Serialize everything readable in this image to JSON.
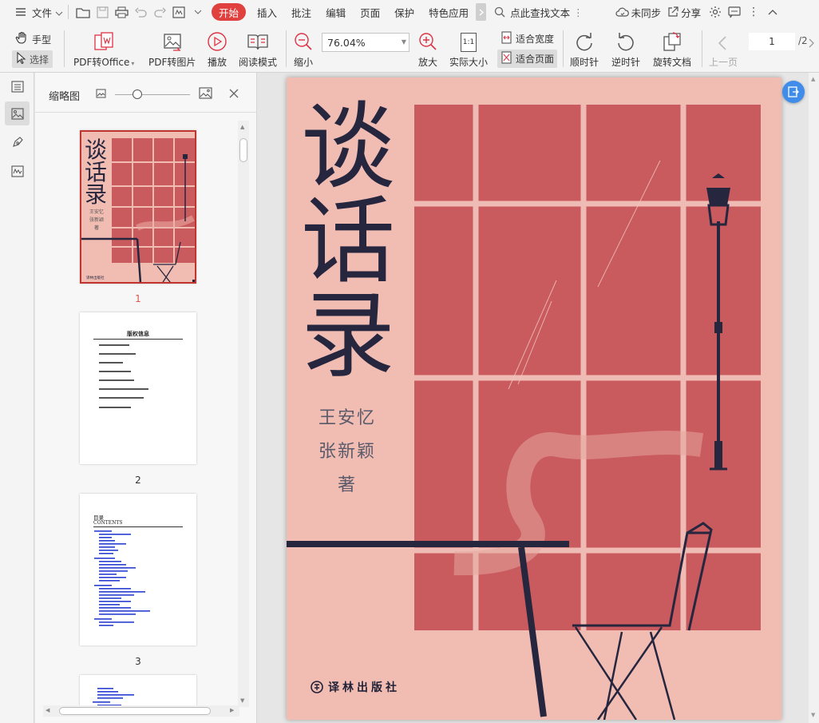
{
  "menubar": {
    "file_label": "文件",
    "tabs": [
      "开始",
      "插入",
      "批注",
      "编辑",
      "页面",
      "保护",
      "特色应用"
    ],
    "search_label": "点此查找文本",
    "sync_label": "未同步",
    "share_label": "分享"
  },
  "ribbon": {
    "hand_label": "手型",
    "select_label": "选择",
    "pdf_to_office_label": "PDF转Office",
    "pdf_to_image_label": "PDF转图片",
    "play_label": "播放",
    "read_mode_label": "阅读模式",
    "zoom_out_label": "缩小",
    "zoom_value": "76.04%",
    "zoom_in_label": "放大",
    "actual_size_label": "实际大小",
    "actual_size_icon_text": "1:1",
    "fit_width_label": "适合宽度",
    "fit_page_label": "适合页面",
    "clockwise_label": "顺时针",
    "counter_clockwise_label": "逆时针",
    "rotate_doc_label": "旋转文档",
    "prev_page_label": "上一页",
    "current_page": "1",
    "total_pages": "/2"
  },
  "thumbnail_panel": {
    "title": "缩略图",
    "page_numbers": [
      "1",
      "2",
      "3"
    ],
    "page2_heading": "版权信息",
    "page3_heading": "目录",
    "page3_subheading": "CONTENTS"
  },
  "cover": {
    "title_chars": [
      "谈",
      "话",
      "录"
    ],
    "authors": [
      "王安忆",
      "张新颖"
    ],
    "author_suffix": "著",
    "publisher": "译林出版社",
    "thumb_authors_line1": "王安忆",
    "thumb_authors_line2": "张新颖",
    "thumb_author_suffix": "著",
    "thumb_publisher": "译林出版社"
  },
  "colors": {
    "accent": "#e0413e",
    "cover_bg": "#f1bdb3",
    "window_red": "#c95a5e",
    "title_navy": "#26263f"
  }
}
